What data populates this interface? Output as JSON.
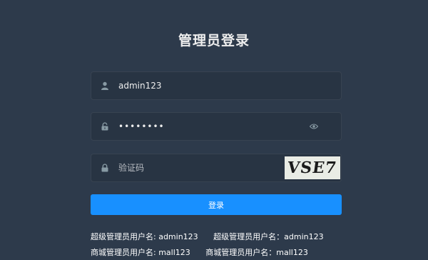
{
  "title": "管理员登录",
  "username": {
    "value": "admin123",
    "icon": "user-icon"
  },
  "password": {
    "value": "••••••••",
    "icon": "lock-icon",
    "toggle_icon": "eye-icon"
  },
  "captcha": {
    "placeholder": "验证码",
    "icon": "lock-icon",
    "image_text": "VSE7"
  },
  "login_button": "登录",
  "tips": {
    "line1": [
      "超级管理员用户名: admin123",
      "超级管理员用户名：admin123"
    ],
    "line2": [
      "商城管理员用户名: mall123",
      "商城管理员用户名：mall123"
    ]
  },
  "colors": {
    "background": "#2d3a4b",
    "field_bg": "#283443",
    "primary": "#1890ff"
  }
}
